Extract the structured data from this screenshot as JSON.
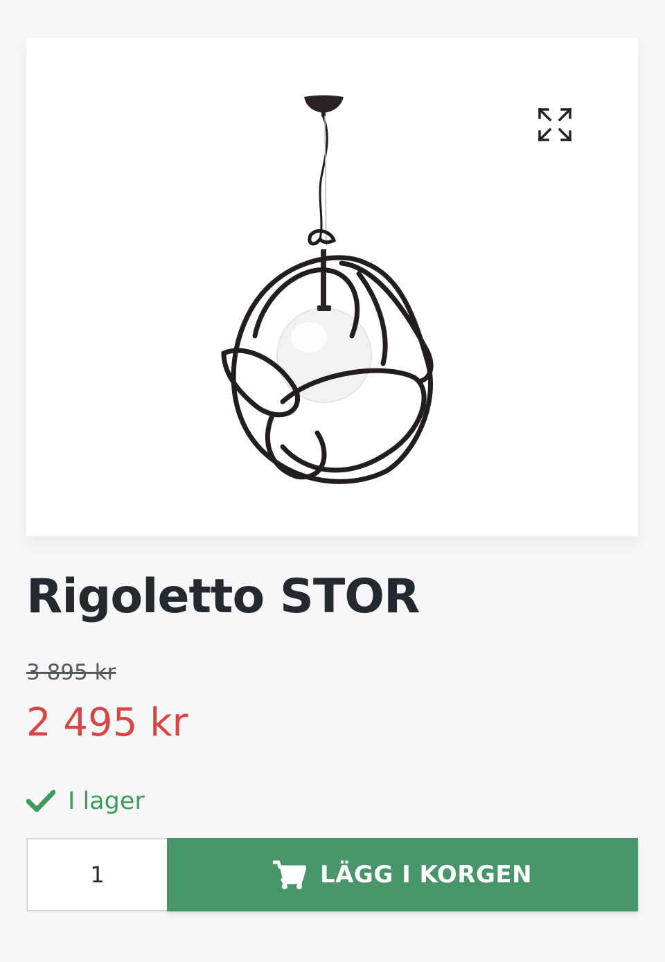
{
  "product": {
    "title": "Rigoletto STOR",
    "original_price": "3 895 kr",
    "sale_price": "2 495 kr",
    "stock_status": "I lager",
    "quantity": "1",
    "add_to_cart_label": "LÄGG I KORGEN"
  },
  "gallery": {
    "image_subject": "pendant-lamp",
    "expand_icon": "expand-arrows-icon"
  },
  "colors": {
    "sale_price": "#d94444",
    "in_stock": "#3e9a5a",
    "add_to_cart_button": "#48956a",
    "title": "#24292f"
  }
}
